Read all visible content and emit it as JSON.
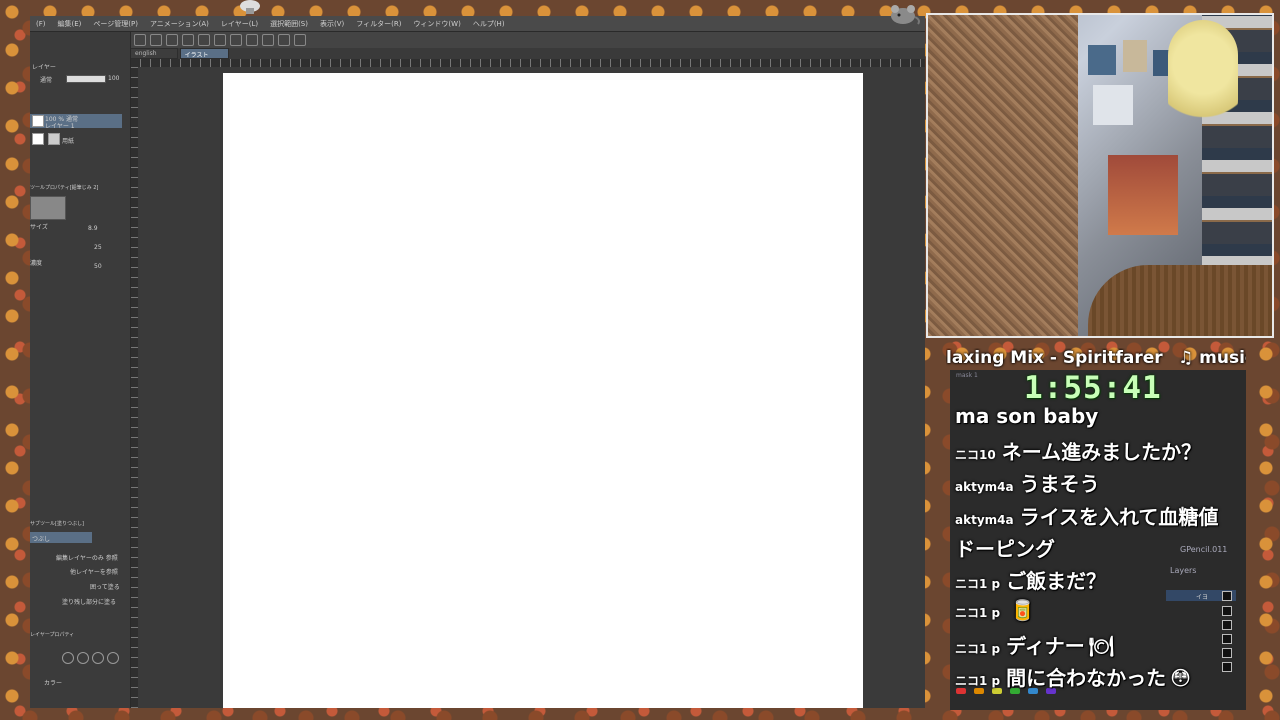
{
  "menubar": {
    "items": [
      "(F)",
      "編集(E)",
      "ページ管理(P)",
      "アニメーション(A)",
      "レイヤー(L)",
      "選択範囲(S)",
      "表示(V)",
      "フィルター(R)",
      "ウィンドウ(W)",
      "ヘルプ(H)"
    ]
  },
  "tabs": [
    {
      "label": "english"
    },
    {
      "label": "イラスト"
    }
  ],
  "left_panel": {
    "layer_header": "レイヤー",
    "blend_mode": "通常",
    "opacity": "100",
    "layer1_name_line1": "100 % 通常",
    "layer1_name_line2": "レイヤー 1",
    "layer2_name": "用紙",
    "tool_property_title": "ツールプロパティ[鉛筆じみ 2]",
    "size_label": "サイズ",
    "size_value": "8.9",
    "value_2": "25",
    "density_label": "濃度",
    "density_value": "50",
    "sub_tool_title": "サブツール[塗りつぶし]",
    "sub_tool_selected": "つぶし",
    "option1": "編集レイヤーのみ 参照",
    "option2": "他レイヤーを参照",
    "option3": "囲って塗る",
    "option4": "塗り残し部分に塗る",
    "layer_property_title": "レイヤープロパティ",
    "color_label": "カラー"
  },
  "music": {
    "title": "laxing Mix - Spiritfarer",
    "tag": "♫ music"
  },
  "timer": "1:55:41",
  "obs": {
    "gpencil": "GPencil.011",
    "layers_title": "Layers",
    "selected_layer": "イヨ",
    "mask_label": "mask 1"
  },
  "chat": [
    {
      "user": "",
      "message": "ma son baby",
      "emoji": ""
    },
    {
      "user": "ニコ10",
      "message": "ネーム進みましたか？",
      "emoji": ""
    },
    {
      "user": "aktym4a",
      "message": "うまそう",
      "emoji": ""
    },
    {
      "user": "aktym4a",
      "message": "ライスを入れて血糖値",
      "emoji": ""
    },
    {
      "user": "",
      "message": "ドーピング",
      "emoji": ""
    },
    {
      "user": "ニコ1 p",
      "message": "ご飯まだ？",
      "emoji": ""
    },
    {
      "user": "ニコ1 p",
      "message": "",
      "emoji": "🥫"
    },
    {
      "user": "ニコ1 p",
      "message": "ディナー",
      "emoji": "🍽"
    },
    {
      "user": "ニコ1 p",
      "message": "間に合わなかった",
      "emoji": "😳"
    }
  ],
  "colors": {
    "timer_text": "#c8ffb8",
    "canvas": "#ffffff",
    "selection_blue": "#5a6f86"
  },
  "icons": [
    "mouse-icon",
    "cursor-icon",
    "pencil-icon",
    "undo-icon",
    "redo-icon",
    "layer-icon",
    "music-note-icon"
  ]
}
